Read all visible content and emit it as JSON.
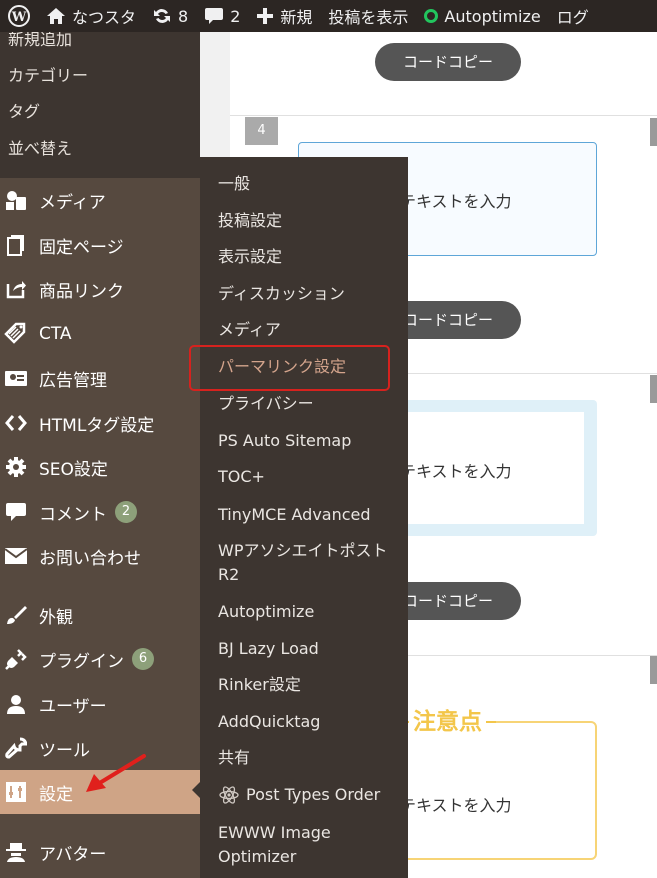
{
  "adminbar": {
    "site_name": "なつスタ",
    "updates_count": "8",
    "comments_count": "2",
    "new_label": "新規",
    "view_post_label": "投稿を表示",
    "autoptimize_label": "Autoptimize",
    "logout_label": "ログ"
  },
  "sidebar": {
    "post_submenu": [
      "新規追加",
      "カテゴリー",
      "タグ",
      "並べ替え"
    ],
    "items": [
      {
        "label": "メディア",
        "icon": "media-icon"
      },
      {
        "label": "固定ページ",
        "icon": "pages-icon"
      },
      {
        "label": "商品リンク",
        "icon": "share-icon"
      },
      {
        "label": "CTA",
        "icon": "tag-icon"
      },
      {
        "label": "広告管理",
        "icon": "ad-icon"
      },
      {
        "label": "HTMLタグ設定",
        "icon": "code-icon"
      },
      {
        "label": "SEO設定",
        "icon": "gear-icon"
      },
      {
        "label": "コメント",
        "icon": "comment-icon",
        "badge": "2"
      },
      {
        "label": "お問い合わせ",
        "icon": "mail-icon"
      },
      {
        "label": "外観",
        "icon": "brush-icon"
      },
      {
        "label": "プラグイン",
        "icon": "plugin-icon",
        "badge": "6"
      },
      {
        "label": "ユーザー",
        "icon": "user-icon"
      },
      {
        "label": "ツール",
        "icon": "wrench-icon"
      },
      {
        "label": "設定",
        "icon": "settings-icon",
        "current": true
      },
      {
        "label": "アバター",
        "icon": "avatar-icon"
      }
    ]
  },
  "settings_flyout": [
    "一般",
    "投稿設定",
    "表示設定",
    "ディスカッション",
    "メディア",
    "パーマリンク設定",
    "プライバシー",
    "PS Auto Sitemap",
    "TOC+",
    "TinyMCE Advanced",
    "WPアソシエイトポストR2",
    "Autoptimize",
    "BJ Lazy Load",
    "Rinker設定",
    "AddQuicktag",
    "共有",
    "Post Types Order",
    "EWWW Image Optimizer"
  ],
  "content": {
    "copy_button_label": "コードコピー",
    "box_number": "4",
    "box_text": "テキストを入力",
    "caution_title": "注意点"
  },
  "colors": {
    "sidebar_bg": "#56493f",
    "submenu_bg": "#3d3530",
    "current_bg": "#cfa486",
    "highlight": "#d6221e",
    "badge_bg": "#8da07a"
  }
}
